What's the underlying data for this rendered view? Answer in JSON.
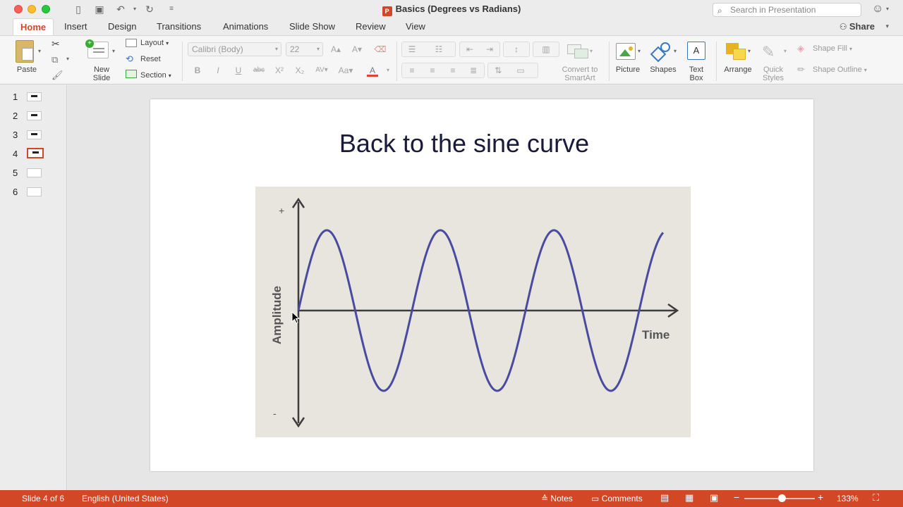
{
  "window": {
    "title": "Basics (Degrees vs Radians)"
  },
  "search": {
    "placeholder": "Search in Presentation"
  },
  "tabs": [
    "Home",
    "Insert",
    "Design",
    "Transitions",
    "Animations",
    "Slide Show",
    "Review",
    "View"
  ],
  "share_label": "Share",
  "ribbon": {
    "paste": "Paste",
    "new_slide_1": "New",
    "new_slide_2": "Slide",
    "layout": "Layout",
    "reset": "Reset",
    "section": "Section",
    "font_name": "Calibri (Body)",
    "font_size": "22",
    "convert_1": "Convert to",
    "convert_2": "SmartArt",
    "picture": "Picture",
    "shapes": "Shapes",
    "textbox_1": "Text",
    "textbox_2": "Box",
    "arrange": "Arrange",
    "quick_1": "Quick",
    "quick_2": "Styles",
    "shape_fill": "Shape Fill",
    "shape_outline": "Shape Outline"
  },
  "slides": [
    "1",
    "2",
    "3",
    "4",
    "5",
    "6"
  ],
  "selected_slide": 4,
  "slide": {
    "title": "Back to the sine curve",
    "graph": {
      "y_label": "Amplitude",
      "x_label": "Time",
      "plus": "+",
      "minus": "-"
    }
  },
  "status": {
    "slide_info": "Slide 4 of 6",
    "language": "English (United States)",
    "notes": "Notes",
    "comments": "Comments",
    "zoom": "133%"
  },
  "colors": {
    "accent": "#d24726",
    "curve": "#4a4aa0"
  }
}
